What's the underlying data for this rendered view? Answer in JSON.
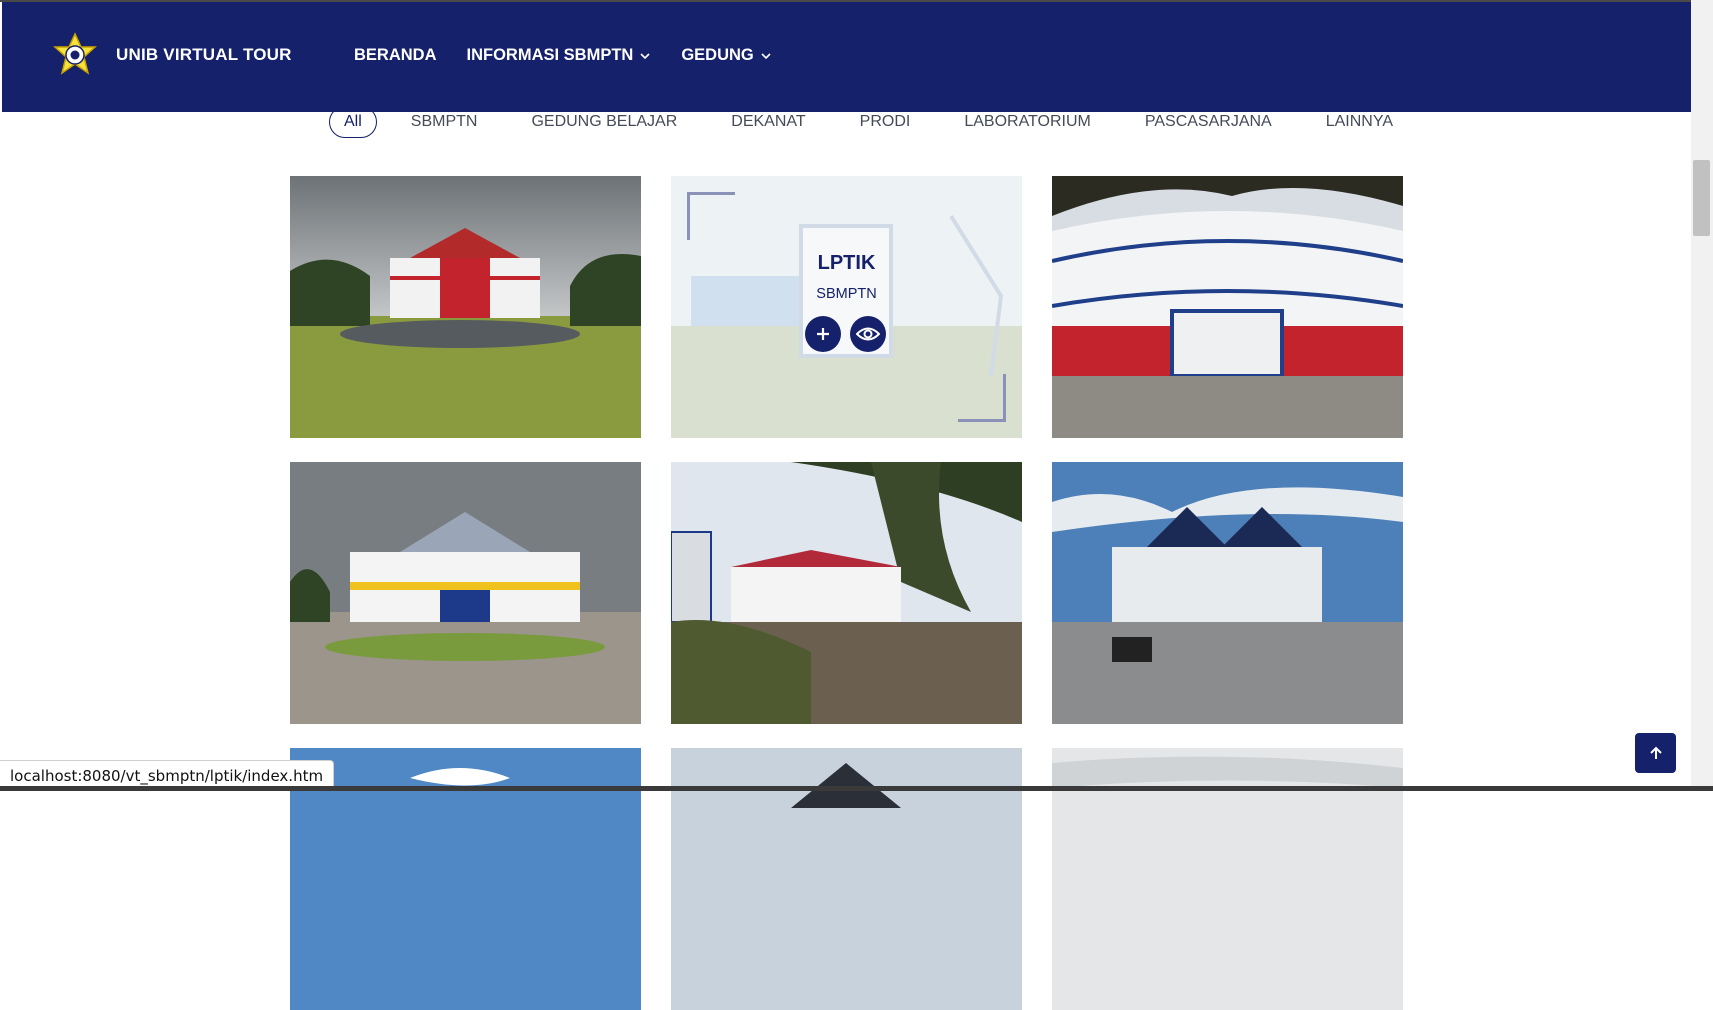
{
  "header": {
    "brand": "UNIB VIRTUAL TOUR",
    "nav": [
      {
        "label": "BERANDA"
      },
      {
        "label": "INFORMASI SBMPTN"
      },
      {
        "label": "GEDUNG"
      }
    ]
  },
  "filters": [
    "All",
    "SBMPTN",
    "GEDUNG BELAJAR",
    "DEKANAT",
    "PRODI",
    "LABORATORIUM",
    "PASCASARJANA",
    "LAINNYA"
  ],
  "active_filter": "All",
  "gallery": {
    "hovered": {
      "title": "LPTIK",
      "subtitle": "SBMPTN"
    }
  },
  "status_url": "localhost:8080/vt_sbmptn/lptik/index.htm",
  "colors": {
    "primary": "#15216b",
    "accent_yellow": "#f5e23a",
    "roof_red": "#c2232c"
  },
  "icons": [
    "unib-logo-icon",
    "chevron-down-icon",
    "plus-icon",
    "eye-icon",
    "arrow-up-icon"
  ]
}
